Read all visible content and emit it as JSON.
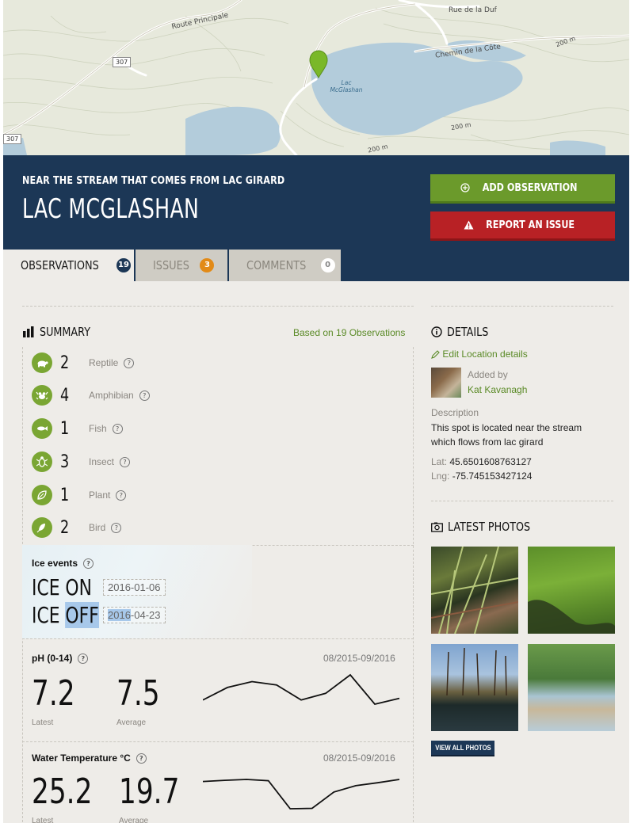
{
  "map": {
    "roads": {
      "route_principale": "Route Principale",
      "rue_de_la": "Rue de la Duf",
      "chemin_de_la_cote": "Chemin de la Côte"
    },
    "shields": [
      "307",
      "307"
    ],
    "lake_name_line1": "Lac",
    "lake_name_line2": "McGlashan",
    "contours": [
      "200 m",
      "200 m",
      "200 m"
    ],
    "colors": {
      "land": "#e7e9dc",
      "water": "#b3ccdb",
      "marker": "#7ab829"
    }
  },
  "header": {
    "subtitle": "NEAR THE STREAM THAT COMES FROM LAC GIRARD",
    "title": "LAC MCGLASHAN",
    "add_observation": "ADD OBSERVATION",
    "report_issue": "REPORT AN ISSUE",
    "colors": {
      "bg": "#1c3756",
      "add": "#6b9a2b",
      "report": "#b82125"
    }
  },
  "tabs": [
    {
      "label": "OBSERVATIONS",
      "count": "19"
    },
    {
      "label": "ISSUES",
      "count": "3"
    },
    {
      "label": "COMMENTS",
      "count": "0"
    }
  ],
  "summary": {
    "title": "SUMMARY",
    "based_on": "Based on 19 Observations",
    "rows": [
      {
        "icon": "turtle-icon",
        "count": "2",
        "label": "Reptile"
      },
      {
        "icon": "frog-icon",
        "count": "4",
        "label": "Amphibian"
      },
      {
        "icon": "fish-icon",
        "count": "1",
        "label": "Fish"
      },
      {
        "icon": "bug-icon",
        "count": "3",
        "label": "Insect"
      },
      {
        "icon": "leaf-icon",
        "count": "1",
        "label": "Plant"
      },
      {
        "icon": "feather-icon",
        "count": "2",
        "label": "Bird"
      }
    ],
    "help_glyph": "?"
  },
  "ice": {
    "title": "Ice events",
    "on_label": "ICE ON",
    "on_date": "2016-01-06",
    "off_label_ice": "ICE",
    "off_label_off": "OFF",
    "off_date_year": "2016",
    "off_date_rest": "-04-23"
  },
  "metrics": [
    {
      "title": "pH (0-14)",
      "range": "08/2015-09/2016",
      "latest": "7.2",
      "average": "7.5",
      "latest_label": "Latest",
      "average_label": "Average",
      "trend": [
        7.0,
        7.15,
        7.22,
        7.18,
        7.0,
        7.08,
        7.3,
        6.95,
        7.02
      ]
    },
    {
      "title": "Water Temperature °C",
      "range": "08/2015-09/2016",
      "latest": "25.2",
      "average": "19.7",
      "latest_label": "Latest",
      "average_label": "Average",
      "trend": [
        24.5,
        24.8,
        25.0,
        24.7,
        18.0,
        18.1,
        22.0,
        23.5,
        24.2,
        25.0
      ]
    }
  ],
  "details": {
    "title": "DETAILS",
    "edit_link": "Edit Location details",
    "added_by_label": "Added by",
    "added_by_name": "Kat Kavanagh",
    "description_label": "Description",
    "description": "This spot is located near the stream which flows from lac girard",
    "lat_label": "Lat:",
    "lat": "45.6501608763127",
    "lng_label": "Lng:",
    "lng": "-75.745153427124"
  },
  "photos": {
    "title": "LATEST PHOTOS",
    "view_all": "VIEW ALL PHOTOS"
  }
}
